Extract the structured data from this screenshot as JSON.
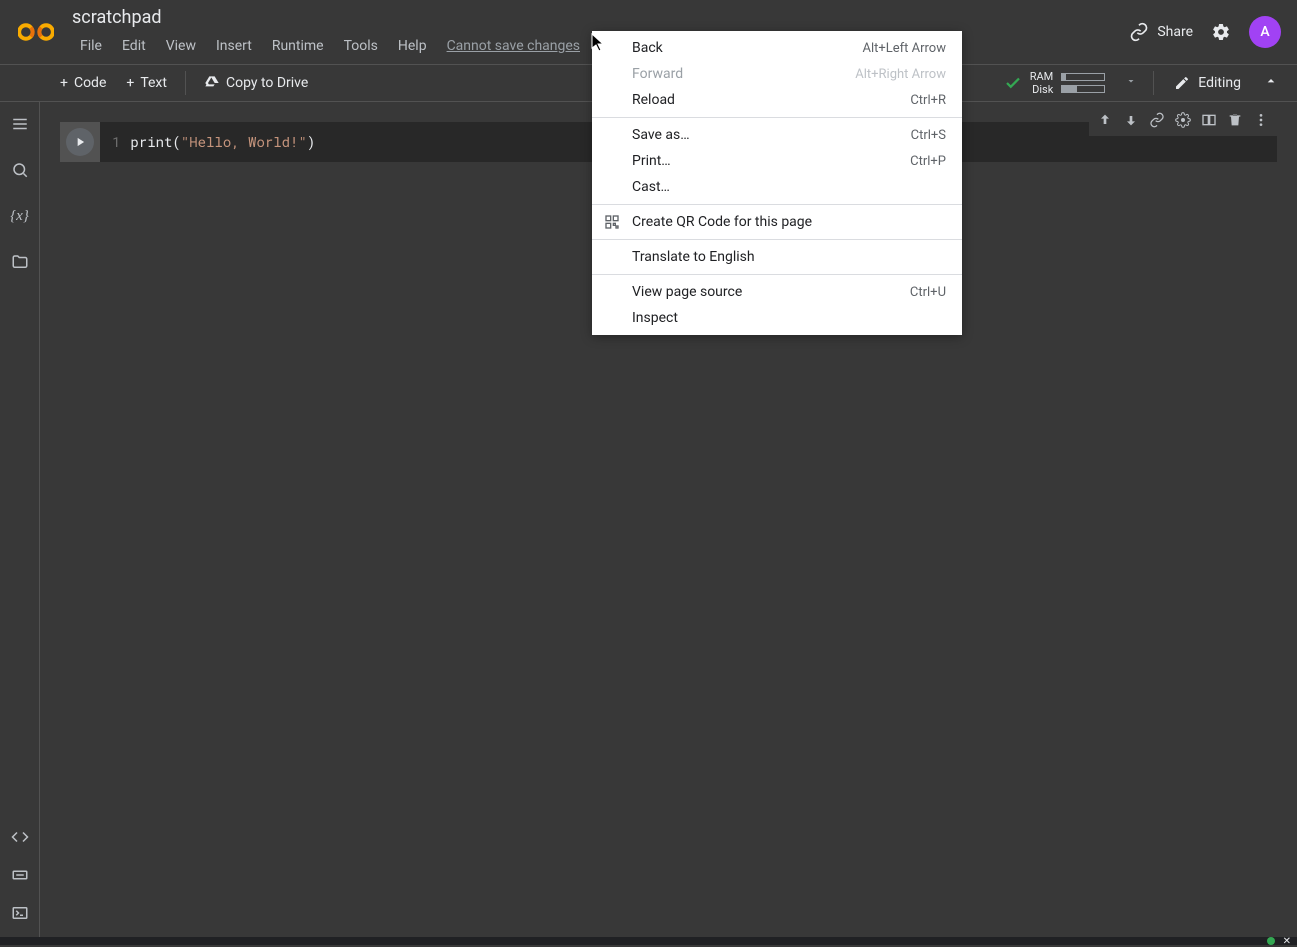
{
  "header": {
    "title": "scratchpad",
    "menus": [
      "File",
      "Edit",
      "View",
      "Insert",
      "Runtime",
      "Tools",
      "Help"
    ],
    "cannot_save": "Cannot save changes",
    "share": "Share",
    "avatar_letter": "A"
  },
  "toolbar": {
    "code": "Code",
    "text": "Text",
    "copy_drive": "Copy to Drive",
    "ram": "RAM",
    "disk": "Disk",
    "editing": "Editing"
  },
  "cell": {
    "line_num": "1",
    "code_prefix": "print",
    "paren_open": "(",
    "string": "\"Hello, World!\"",
    "paren_close": ")"
  },
  "context_menu": [
    {
      "label": "Back",
      "shortcut": "Alt+Left Arrow",
      "disabled": false,
      "sep": false
    },
    {
      "label": "Forward",
      "shortcut": "Alt+Right Arrow",
      "disabled": true,
      "sep": false
    },
    {
      "label": "Reload",
      "shortcut": "Ctrl+R",
      "disabled": false,
      "sep": false
    },
    {
      "sep": true
    },
    {
      "label": "Save as…",
      "shortcut": "Ctrl+S",
      "disabled": false,
      "sep": false
    },
    {
      "label": "Print…",
      "shortcut": "Ctrl+P",
      "disabled": false,
      "sep": false
    },
    {
      "label": "Cast…",
      "shortcut": "",
      "disabled": false,
      "sep": false
    },
    {
      "sep": true
    },
    {
      "label": "Create QR Code for this page",
      "shortcut": "",
      "disabled": false,
      "icon": "qr",
      "sep": false
    },
    {
      "sep": true
    },
    {
      "label": "Translate to English",
      "shortcut": "",
      "disabled": false,
      "sep": false
    },
    {
      "sep": true
    },
    {
      "label": "View page source",
      "shortcut": "Ctrl+U",
      "disabled": false,
      "sep": false
    },
    {
      "label": "Inspect",
      "shortcut": "",
      "disabled": false,
      "sep": false
    }
  ]
}
